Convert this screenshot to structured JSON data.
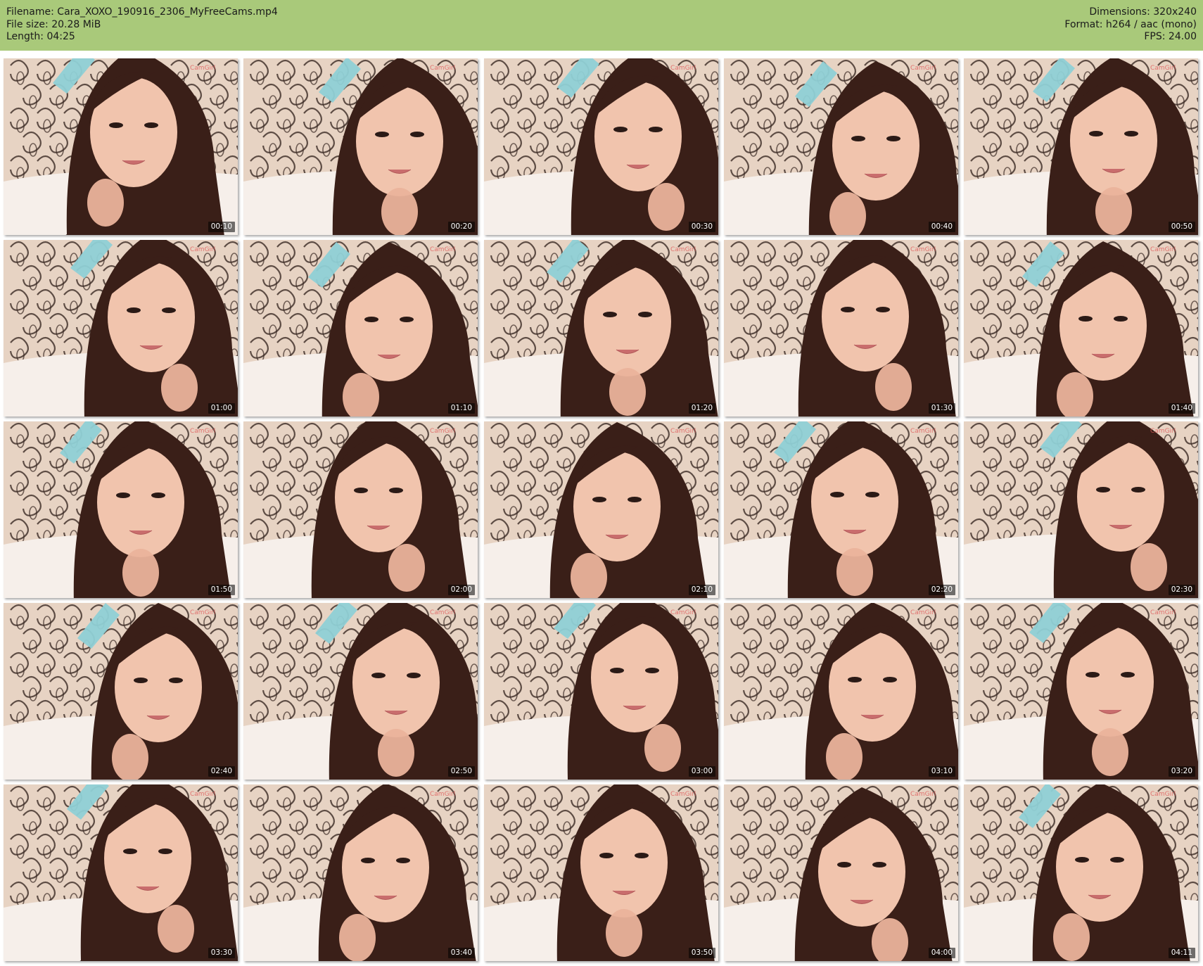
{
  "header": {
    "filename": "Filename: Cara_XOXO_190916_2306_MyFreeCams.mp4",
    "file_size": "File size: 20.28 MiB",
    "length": "Length: 04:25",
    "dimensions": "Dimensions: 320x240",
    "format": "Format: h264 / aac (mono)",
    "fps": "FPS: 24.00"
  },
  "thumbnails": [
    {
      "time": "00:10"
    },
    {
      "time": "00:20"
    },
    {
      "time": "00:30"
    },
    {
      "time": "00:40"
    },
    {
      "time": "00:50"
    },
    {
      "time": "01:00"
    },
    {
      "time": "01:10"
    },
    {
      "time": "01:20"
    },
    {
      "time": "01:30"
    },
    {
      "time": "01:40"
    },
    {
      "time": "01:50"
    },
    {
      "time": "02:00"
    },
    {
      "time": "02:10"
    },
    {
      "time": "02:20"
    },
    {
      "time": "02:30"
    },
    {
      "time": "02:40"
    },
    {
      "time": "02:50"
    },
    {
      "time": "03:00"
    },
    {
      "time": "03:10"
    },
    {
      "time": "03:20"
    },
    {
      "time": "03:30"
    },
    {
      "time": "03:40"
    },
    {
      "time": "03:50"
    },
    {
      "time": "04:00"
    },
    {
      "time": "04:11"
    }
  ],
  "colors": {
    "header_bg": "#a9c97a",
    "wallpaper": "#e7d3c3",
    "wallpaper_pattern": "#3b2a24",
    "hair": "#3a1f18",
    "skin": "#f1c4ad",
    "bed": "#f6efea",
    "ribbon": "#8fd0d6"
  }
}
